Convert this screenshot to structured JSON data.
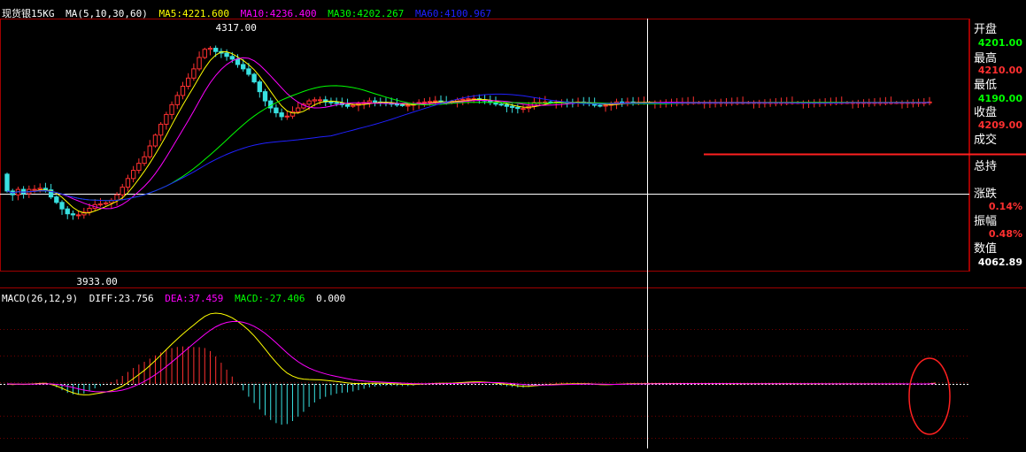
{
  "header": {
    "symbol": "现货银15KG",
    "ma_params": "MA(5,10,30,60)",
    "ma5": "MA5:4221.600",
    "ma10": "MA10:4236.400",
    "ma30": "MA30:4202.267",
    "ma60": "MA60:4100.967",
    "colors": {
      "ma5": "#ffff00",
      "ma10": "#ff00ff",
      "ma30": "#00ff00",
      "ma60": "#2020ff"
    }
  },
  "macd_header": {
    "params": "MACD(26,12,9)",
    "diff": "DIFF:23.756",
    "dea": "DEA:37.459",
    "macd": "MACD:-27.406",
    "zero": "0.000"
  },
  "annotations": {
    "high": "4317.00",
    "low": "3933.00"
  },
  "side_panel": {
    "open_label": "开盘",
    "open_value": "4201.00",
    "high_label": "最高",
    "high_value": "4210.00",
    "low_label": "最低",
    "low_value": "4190.00",
    "close_label": "收盘",
    "close_value": "4209.00",
    "volume_label": "成交",
    "position_label": "总持",
    "change_label": "涨跌",
    "change_value": "0.14%",
    "amplitude_label": "振幅",
    "amplitude_value": "0.48%",
    "value_label": "数值",
    "value_value": "4062.89"
  },
  "chart_data": [
    {
      "type": "candlestick",
      "title": "现货银15KG",
      "ylim": [
        3900,
        4340
      ],
      "x": [
        0,
        1,
        2,
        3,
        4,
        5,
        6,
        7,
        8,
        9,
        10,
        11,
        12,
        13,
        14,
        15,
        16,
        17,
        18,
        19,
        20,
        21,
        22,
        23,
        24,
        25,
        26,
        27,
        28,
        29,
        30,
        31,
        32,
        33,
        34,
        35,
        36,
        37,
        38,
        39,
        40,
        41,
        42,
        43,
        44,
        45,
        46,
        47,
        48,
        49,
        50,
        51,
        52,
        53,
        54,
        55,
        56,
        57,
        58,
        59,
        60,
        61,
        62,
        63,
        64,
        65,
        66,
        67,
        68,
        69,
        70,
        71,
        72,
        73,
        74,
        75,
        76,
        77,
        78,
        79,
        80,
        81,
        82,
        83,
        84,
        85,
        86,
        87,
        88,
        89,
        90,
        91,
        92,
        93,
        94,
        95,
        96,
        97,
        98,
        99,
        100,
        101,
        102,
        103,
        104,
        105,
        106,
        107,
        108,
        109,
        110,
        111,
        112,
        113,
        114,
        115,
        116,
        117,
        118,
        119,
        120,
        121,
        122,
        123,
        124,
        125,
        126,
        127,
        128,
        129,
        130,
        131,
        132,
        133,
        134,
        135,
        136,
        137,
        138,
        139,
        140,
        141,
        142,
        143,
        144,
        145,
        146,
        147,
        148,
        149,
        150,
        151,
        152,
        153,
        154,
        155,
        156,
        157,
        158,
        159,
        160,
        161,
        162,
        163,
        164,
        165,
        166,
        167,
        168,
        169,
        170,
        171,
        172,
        173
      ],
      "open": [
        4068,
        4037,
        4030,
        4040,
        4032,
        4040,
        4040,
        4042,
        4039,
        4026,
        4016,
        4004,
        3995,
        3993,
        3993,
        3998,
        4005,
        4012,
        4013,
        4015,
        4020,
        4030,
        4044,
        4060,
        4075,
        4088,
        4100,
        4120,
        4140,
        4160,
        4178,
        4196,
        4213,
        4230,
        4245,
        4262,
        4283,
        4298,
        4300,
        4294,
        4291,
        4285,
        4280,
        4270,
        4262,
        4252,
        4238,
        4220,
        4203,
        4190,
        4181,
        4174,
        4175,
        4183,
        4190,
        4197,
        4203,
        4205,
        4205,
        4201,
        4200,
        4199,
        4196,
        4193,
        4195,
        4198,
        4200,
        4203,
        4201,
        4200,
        4199,
        4197,
        4196,
        4195,
        4195,
        4197,
        4200,
        4201,
        4202,
        4203,
        4201,
        4200,
        4202,
        4205,
        4206,
        4207,
        4207,
        4205,
        4203,
        4200,
        4197,
        4196,
        4193,
        4191,
        4189,
        4189,
        4193,
        4200,
        4200,
        4201,
        4200,
        4201,
        4201,
        4200,
        4199,
        4201,
        4200,
        4198,
        4195,
        4194,
        4195,
        4197,
        4201,
        4200,
        4201,
        4200,
        4200,
        4200,
        4200,
        4200,
        4200,
        4200,
        4200,
        4200,
        4200,
        4200,
        4200,
        4200,
        4200,
        4200,
        4200,
        4200,
        4200,
        4200,
        4200,
        4200,
        4200,
        4200,
        4200,
        4200,
        4200,
        4200,
        4200,
        4200,
        4200,
        4200,
        4200,
        4200,
        4200,
        4200,
        4200,
        4200,
        4200,
        4200,
        4200,
        4200,
        4200,
        4200,
        4200,
        4200,
        4200,
        4200,
        4200,
        4200,
        4200,
        4200,
        4200,
        4200,
        4201
      ],
      "close": [
        4037,
        4030,
        4040,
        4032,
        4040,
        4040,
        4042,
        4039,
        4026,
        4016,
        4004,
        3995,
        3993,
        3993,
        3998,
        4005,
        4012,
        4013,
        4015,
        4020,
        4030,
        4044,
        4060,
        4075,
        4088,
        4100,
        4120,
        4140,
        4160,
        4178,
        4196,
        4213,
        4230,
        4245,
        4262,
        4283,
        4298,
        4300,
        4294,
        4291,
        4285,
        4280,
        4270,
        4262,
        4252,
        4238,
        4220,
        4203,
        4190,
        4181,
        4174,
        4175,
        4183,
        4190,
        4197,
        4203,
        4205,
        4205,
        4201,
        4200,
        4199,
        4196,
        4193,
        4195,
        4198,
        4200,
        4203,
        4201,
        4200,
        4199,
        4197,
        4196,
        4195,
        4195,
        4197,
        4200,
        4201,
        4202,
        4203,
        4201,
        4200,
        4202,
        4205,
        4206,
        4207,
        4207,
        4205,
        4203,
        4200,
        4197,
        4196,
        4193,
        4191,
        4189,
        4189,
        4193,
        4200,
        4200,
        4201,
        4200,
        4201,
        4201,
        4200,
        4199,
        4201,
        4200,
        4198,
        4195,
        4194,
        4195,
        4197,
        4201,
        4200,
        4201,
        4200,
        4200,
        4200,
        4200,
        4200,
        4200,
        4200,
        4200,
        4200,
        4200,
        4200,
        4200,
        4200,
        4200,
        4200,
        4200,
        4200,
        4200,
        4200,
        4200,
        4200,
        4200,
        4200,
        4200,
        4200,
        4200,
        4200,
        4200,
        4200,
        4200,
        4200,
        4200,
        4200,
        4200,
        4200,
        4200,
        4200,
        4200,
        4200,
        4200,
        4200,
        4200,
        4200,
        4200,
        4200,
        4200,
        4200,
        4200,
        4200,
        4200,
        4200,
        4200,
        4200,
        4200,
        4201,
        4209
      ],
      "series": [
        {
          "name": "MA5",
          "color": "#ffff00"
        },
        {
          "name": "MA10",
          "color": "#ff00ff"
        },
        {
          "name": "MA30",
          "color": "#00ff00"
        },
        {
          "name": "MA60",
          "color": "#2020ff"
        }
      ]
    },
    {
      "type": "line",
      "title": "MACD(26,12,9)",
      "series": [
        {
          "name": "DIFF",
          "color": "#ffff00"
        },
        {
          "name": "DEA",
          "color": "#ff00ff"
        },
        {
          "name": "MACD",
          "color": "#ff3030"
        }
      ]
    }
  ]
}
